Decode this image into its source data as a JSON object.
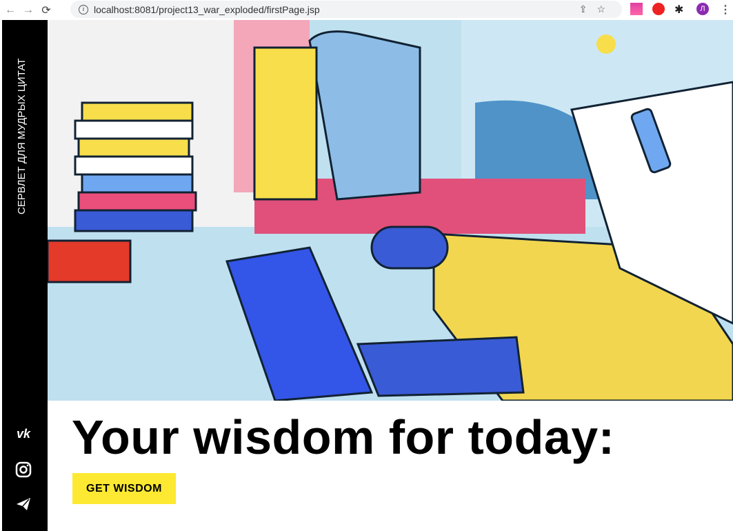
{
  "browser": {
    "url": "localhost:8081/project13_war_exploded/firstPage.jsp",
    "profile_initial": "Л"
  },
  "sidebar": {
    "title": "СЕРВЛЕТ ДЛЯ МУДРЫХ ЦИТАТ",
    "social": [
      "vk-icon",
      "instagram-icon",
      "telegram-icon"
    ]
  },
  "main": {
    "heading": "Your wisdom for today:",
    "button": "GET WISDOM"
  },
  "colors": {
    "accent": "#fde932",
    "sidebar": "#000000"
  }
}
